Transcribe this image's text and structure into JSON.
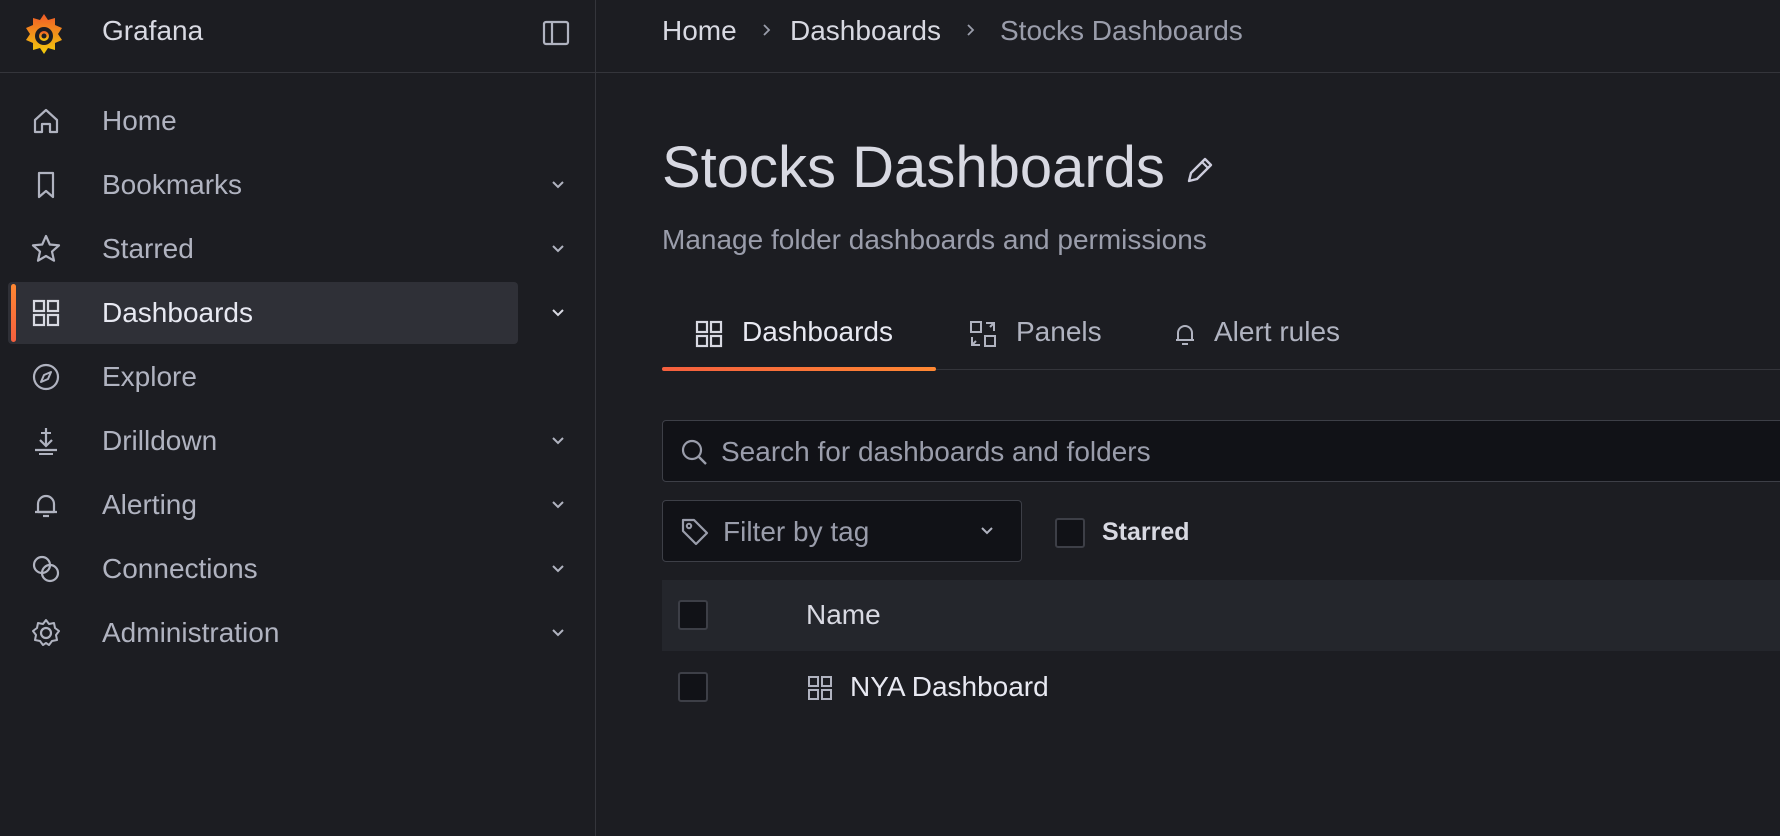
{
  "app": {
    "title": "Grafana"
  },
  "colors": {
    "accent": "#f55f3e",
    "accent_secondary": "#ff8833",
    "background": "#1c1d22"
  },
  "sidebar": {
    "dock_button_icon": "dock-panel-icon",
    "items": [
      {
        "label": "Home",
        "icon": "home-icon",
        "expandable": false,
        "active": false
      },
      {
        "label": "Bookmarks",
        "icon": "bookmark-icon",
        "expandable": true,
        "active": false
      },
      {
        "label": "Starred",
        "icon": "star-icon",
        "expandable": true,
        "active": false
      },
      {
        "label": "Dashboards",
        "icon": "apps-grid-icon",
        "expandable": true,
        "active": true
      },
      {
        "label": "Explore",
        "icon": "compass-icon",
        "expandable": false,
        "active": false
      },
      {
        "label": "Drilldown",
        "icon": "drilldown-icon",
        "expandable": true,
        "active": false
      },
      {
        "label": "Alerting",
        "icon": "bell-icon",
        "expandable": true,
        "active": false
      },
      {
        "label": "Connections",
        "icon": "connections-icon",
        "expandable": true,
        "active": false
      },
      {
        "label": "Administration",
        "icon": "cog-icon",
        "expandable": true,
        "active": false
      }
    ]
  },
  "breadcrumb": [
    "Home",
    "Dashboards",
    "Stocks Dashboards"
  ],
  "page": {
    "title": "Stocks Dashboards",
    "subtitle": "Manage folder dashboards and permissions"
  },
  "tabs": [
    {
      "label": "Dashboards",
      "icon": "apps-grid-icon",
      "active": true
    },
    {
      "label": "Panels",
      "icon": "library-panel-icon",
      "active": false
    },
    {
      "label": "Alert rules",
      "icon": "bell-icon",
      "active": false
    }
  ],
  "search": {
    "placeholder": "Search for dashboards and folders",
    "value": ""
  },
  "filters": {
    "tag_placeholder": "Filter by tag",
    "starred_label": "Starred",
    "starred_checked": false
  },
  "table": {
    "columns": [
      "Name"
    ],
    "rows": [
      {
        "name": "NYA Dashboard",
        "icon": "apps-grid-icon",
        "checked": false
      }
    ]
  }
}
